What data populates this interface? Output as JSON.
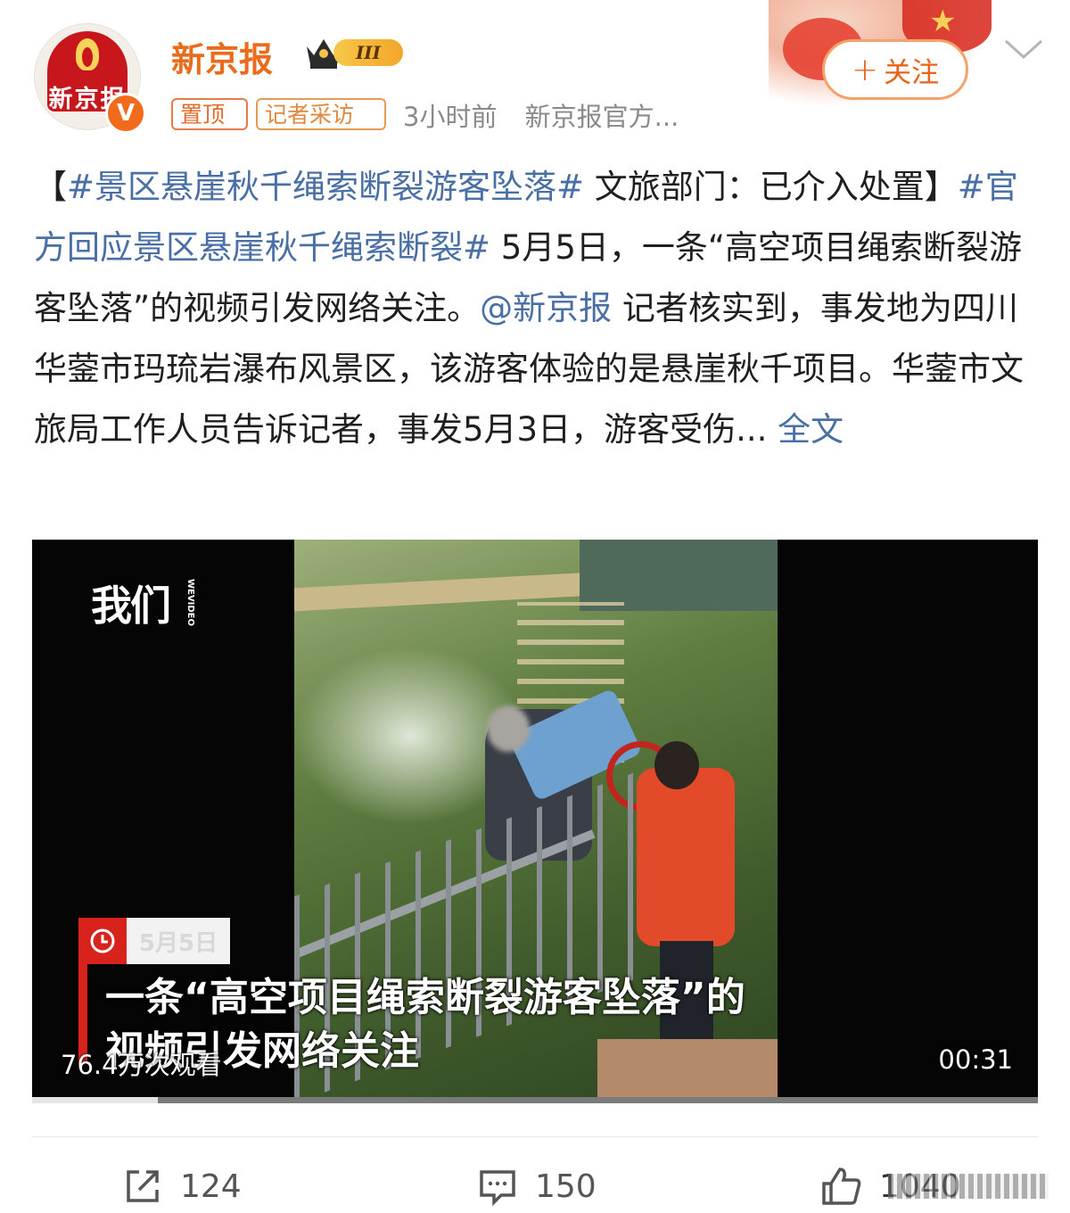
{
  "account": {
    "name": "新京报",
    "avatar_text": "新京报",
    "verified_mark": "V",
    "member_level": "III",
    "tags": [
      "置顶",
      "记者采访"
    ],
    "time": "3小时前",
    "source": "新京报官方...",
    "follow_label": "关注",
    "follow_icon": "plus-icon",
    "more_icon": "chevron-down-icon",
    "accent_color": "#e86c1b"
  },
  "post": {
    "bracket_open": "【",
    "hashtag1": "#景区悬崖秋千绳索断裂游客坠落#",
    "title_rest": " 文旅部门：已介入处置",
    "bracket_close": "】",
    "hashtag2": "#官方回应景区悬崖秋千绳索断裂#",
    "text1": " 5月5日，一条“高空项目绳索断裂游客坠落”的视频引发网络关注。",
    "mention": "@新京报",
    "text2": " 记者核实到，事发地为四川华蓥市玛琉岩瀑布风景区，该游客体验的是悬崖秋千项目。华蓥市文旅局工作人员告诉记者，事发5月3日，游客受伤...",
    "expand_label": " 全文",
    "link_color": "#4a6fa5"
  },
  "video": {
    "logo": "我们",
    "logo_sub": "WEVIDEO",
    "date_label": "5月5日",
    "subtitle_line1": "一条“高空项目绳索断裂游客坠落”的",
    "subtitle_line2": "视频引发网络关注",
    "views": "76.4万次观看",
    "duration": "00:31",
    "progress_fraction": 0.125
  },
  "actions": {
    "share_count": "124",
    "comment_count": "150",
    "like_count": "1040",
    "share_icon": "share-icon",
    "comment_icon": "comment-icon",
    "like_icon": "thumbs-up-icon"
  }
}
